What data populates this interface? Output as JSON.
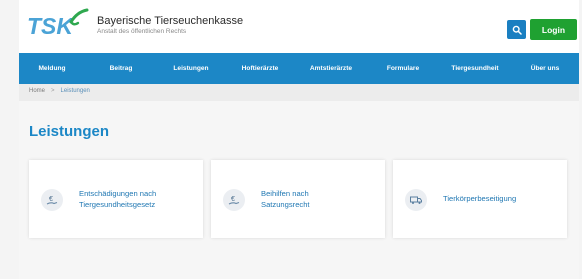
{
  "header": {
    "logo_text": "TSK",
    "brand_title": "Bayerische Tierseuchenkasse",
    "brand_subtitle": "Anstalt des öffentlichen Rechts",
    "search_icon": "search-icon",
    "login_label": "Login"
  },
  "nav": {
    "items": [
      {
        "label": "Meldung"
      },
      {
        "label": "Beitrag"
      },
      {
        "label": "Leistungen"
      },
      {
        "label": "Hoftierärzte"
      },
      {
        "label": "Amtstierärzte"
      },
      {
        "label": "Formulare"
      },
      {
        "label": "Tiergesundheit"
      },
      {
        "label": "Über uns"
      }
    ]
  },
  "breadcrumb": {
    "home": "Home",
    "separator": ">",
    "current": "Leistungen"
  },
  "main": {
    "title": "Leistungen",
    "cards": [
      {
        "line1": "Entschädigungen nach",
        "line2": "Tiergesundheitsgesetz",
        "icon": "euro-hand-icon"
      },
      {
        "line1": "Beihilfen nach",
        "line2": "Satzungsrecht",
        "icon": "euro-hand-icon"
      },
      {
        "line1": "Tierkörperbeseitigung",
        "line2": "",
        "icon": "truck-icon"
      }
    ]
  },
  "colors": {
    "primary": "#1c87c6",
    "login": "#1fa131",
    "link": "#2178b3"
  }
}
